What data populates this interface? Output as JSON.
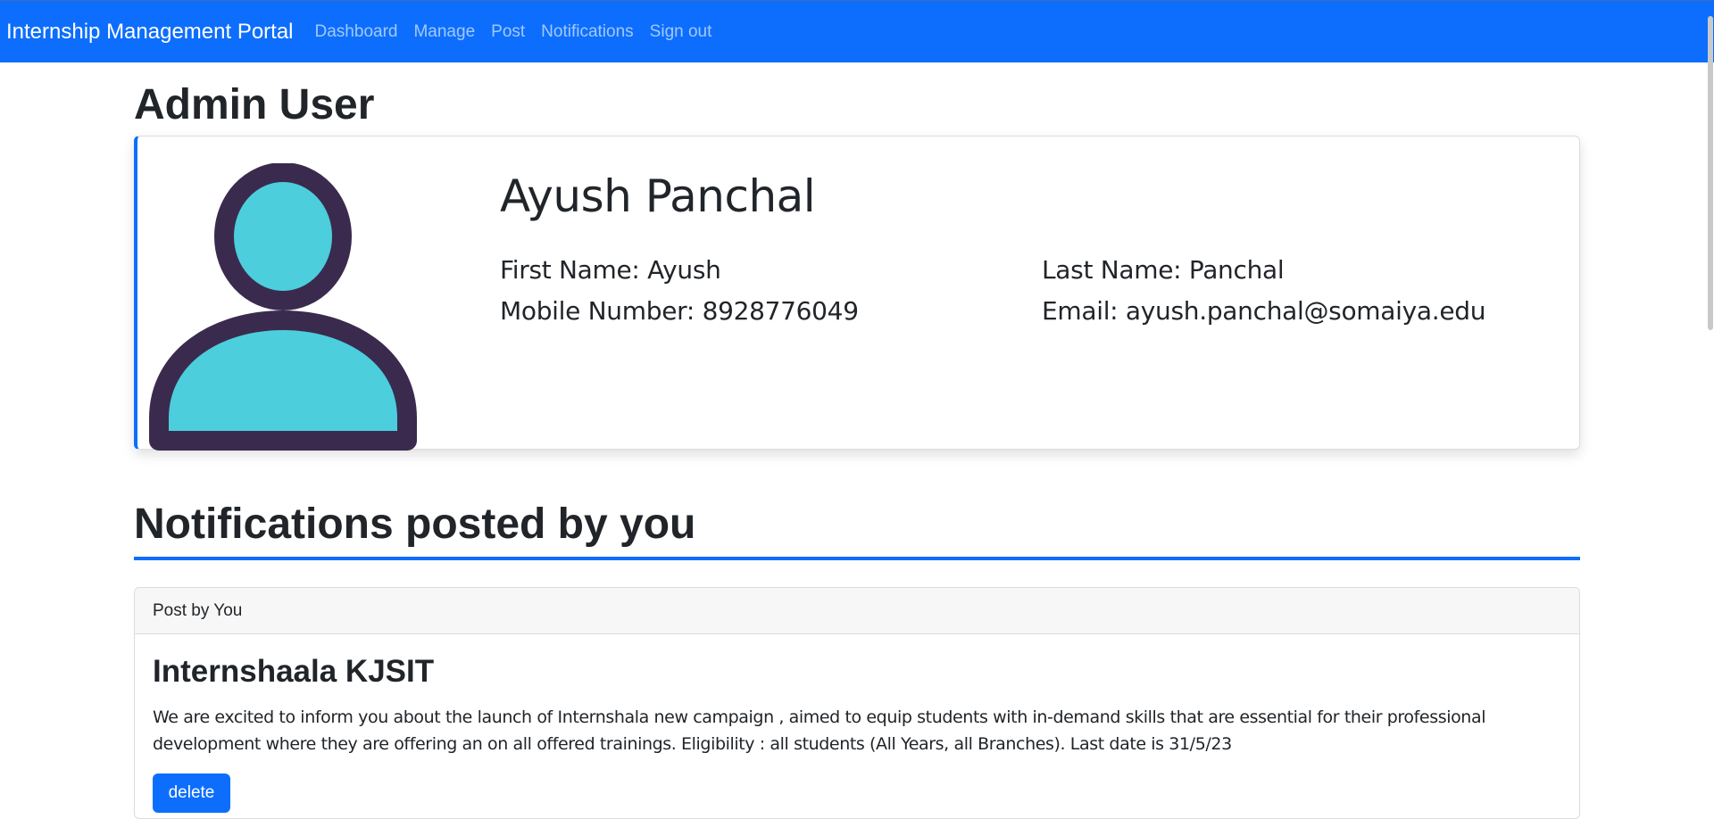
{
  "navbar": {
    "brand": "Internship Management Portal",
    "links": [
      "Dashboard",
      "Manage",
      "Post",
      "Notifications",
      "Sign out"
    ],
    "bg_color": "#0d6efd"
  },
  "admin": {
    "heading": "Admin User",
    "name": "Ayush Panchal",
    "first_name": "First Name: Ayush",
    "last_name": "Last Name: Panchal",
    "mobile": "Mobile Number: 8928776049",
    "email": "Email: ayush.panchal@somaiya.edu",
    "avatar_icon": "user-icon",
    "avatar_colors": {
      "fill": "#4ccedc",
      "outline": "#3a2b4e"
    }
  },
  "notifications": {
    "heading": "Notifications posted by you",
    "posts": [
      {
        "header": "Post by You",
        "title": "Internshaala KJSIT",
        "body": "We are excited to inform you about the launch of Internshala new campaign , aimed to equip students with in-demand skills that are essential for their professional development where they are offering an on all offered trainings. Eligibility : all students (All Years, all Branches). Last date is 31/5/23",
        "delete_label": "delete"
      }
    ]
  }
}
